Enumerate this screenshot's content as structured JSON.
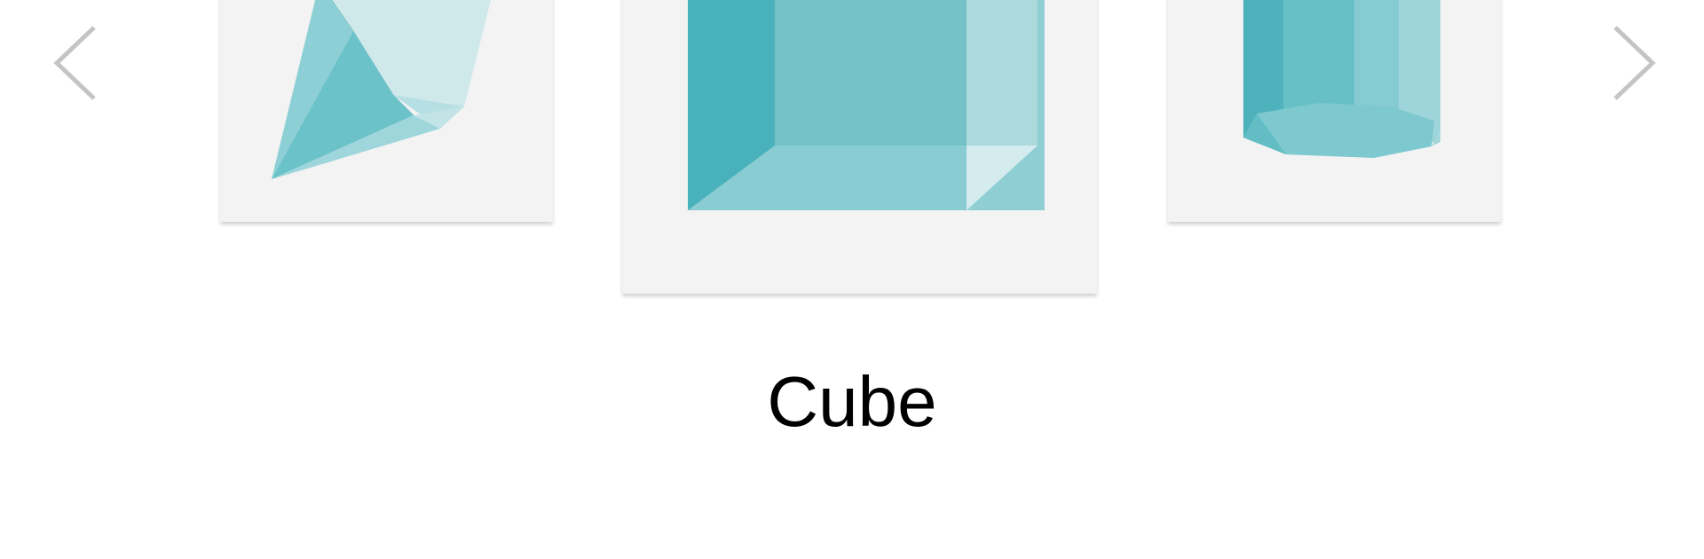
{
  "carousel": {
    "prev_icon": "chevron-left",
    "next_icon": "chevron-right",
    "caption": "Cube",
    "items": [
      {
        "shape": "octahedron-icon",
        "selected": false
      },
      {
        "shape": "cube-icon",
        "selected": true
      },
      {
        "shape": "cylinder-icon",
        "selected": false
      }
    ]
  },
  "colors": {
    "card_bg": "#f3f3f3",
    "shape_teal": "#4ab1bb",
    "arrow_gray": "#c4c4c4",
    "caption_text": "#000000"
  }
}
